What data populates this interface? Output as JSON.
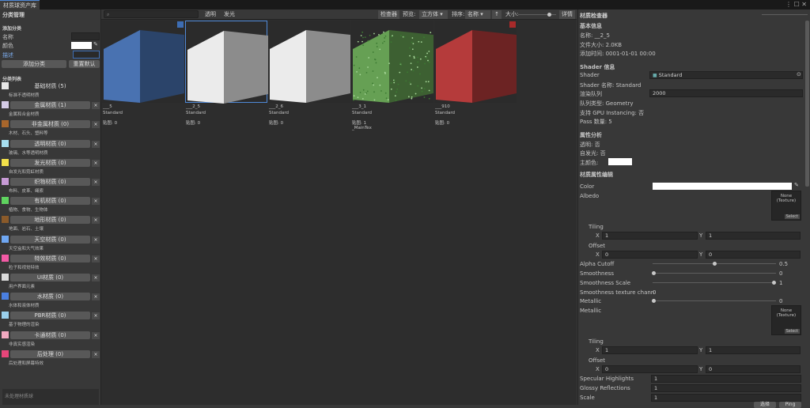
{
  "window": {
    "tab_title": "材质球资产库"
  },
  "left": {
    "section_title": "分类管理",
    "add_title": "添加分类",
    "name_label": "名称",
    "color_label": "颜色",
    "desc_label": "描述",
    "add_btn": "添加分类",
    "reset_btn": "重置默认",
    "list_title": "分类列表",
    "footer": "未处理材质球",
    "categories": [
      {
        "label": "基础材质 (5)",
        "desc": "标准不透明材质",
        "color": "#e6e6e6"
      },
      {
        "label": "金属材质 (1)",
        "desc": "金属和合金材质",
        "color": "#d4cbe6"
      },
      {
        "label": "非金属材质 (0)",
        "desc": "木材、石头、塑料等",
        "color": "#a8662c"
      },
      {
        "label": "透明材质 (0)",
        "desc": "玻璃、水等透明材质",
        "color": "#a7dff0"
      },
      {
        "label": "发光材质 (0)",
        "desc": "自发光和霓虹材质",
        "color": "#f2e04a"
      },
      {
        "label": "织物材质 (0)",
        "desc": "布料、皮革、绳索",
        "color": "#c89bd6"
      },
      {
        "label": "有机材质 (0)",
        "desc": "植物、食物、生物体",
        "color": "#5fd35f"
      },
      {
        "label": "地形材质 (0)",
        "desc": "地面、岩石、土壤",
        "color": "#8a5a2a"
      },
      {
        "label": "天空材质 (0)",
        "desc": "天空盒和大气效果",
        "color": "#6fa7f2"
      },
      {
        "label": "特效材质 (0)",
        "desc": "粒子和视觉特效",
        "color": "#f25aa5"
      },
      {
        "label": "UI材质 (0)",
        "desc": "用户界面元素",
        "color": "#d9d9d9"
      },
      {
        "label": "水材质 (0)",
        "desc": "水体和液体材质",
        "color": "#4a7fe0"
      },
      {
        "label": "PBR材质 (0)",
        "desc": "基于物理的渲染",
        "color": "#9ad0ec"
      },
      {
        "label": "卡通材质 (0)",
        "desc": "非真实感渲染",
        "color": "#f2a9c0"
      },
      {
        "label": "后处理 (0)",
        "desc": "后处理和屏幕特效",
        "color": "#e8467a"
      }
    ]
  },
  "toolbar": {
    "search_placeholder": "",
    "transparent": "透明",
    "emissive": "发光",
    "inspector": "检查器",
    "preview_label": "预览:",
    "preview_value": "立方体",
    "sort_label": "排序:",
    "sort_value": "名称",
    "sort_dir": "↑",
    "size_label": "大小:",
    "details": "详情"
  },
  "materials": [
    {
      "name": "___5",
      "shader": "Standard",
      "maps": "贴图: 0",
      "color": "#4f7cc0",
      "marker": "#3d6db3"
    },
    {
      "name": "___2_5",
      "shader": "Standard",
      "maps": "贴图: 0",
      "color": "#ffffff",
      "marker": ""
    },
    {
      "name": "___2_6",
      "shader": "Standard",
      "maps": "贴图: 0",
      "color": "#ffffff",
      "marker": ""
    },
    {
      "name": "___3_1",
      "shader": "Standard",
      "maps": "贴图: 1\n_MainTex",
      "color": "#6fae5b",
      "marker": ""
    },
    {
      "name": "___910",
      "shader": "Standard",
      "maps": "贴图: 0",
      "color": "#c54040",
      "marker": "#a82a2a"
    }
  ],
  "inspector": {
    "title": "材质检查器",
    "basic_title": "基本信息",
    "name_row": "名称: __2_5",
    "size_row": "文件大小: 2.0KB",
    "time_row": "添加时间: 0001-01-01 00:00",
    "shader_title": "Shader 信息",
    "shader_label": "Shader",
    "shader_value": "Standard",
    "shader_name": "Shader 名称: Standard",
    "queue_label": "渲染队列",
    "queue_value": "2000",
    "queue_type": "队列类型: Geometry",
    "gpu": "支持 GPU Instancing: 否",
    "pass": "Pass 数量: 5",
    "analysis_title": "属性分析",
    "transparent": "透明: 否",
    "emissive": "自发光: 否",
    "main_color": "主颜色:",
    "edit_title": "材质属性编辑",
    "color_label": "Color",
    "albedo": "Albedo",
    "tex_none": "None\n(Texture)",
    "select": "Select",
    "tiling": "Tiling",
    "offset": "Offset",
    "x": "X",
    "y": "Y",
    "tiling_x": "1",
    "tiling_y": "1",
    "offset_x": "0",
    "offset_y": "0",
    "alpha_cutoff": "Alpha Cutoff",
    "alpha_value": "0.5",
    "smoothness": "Smoothness",
    "smoothness_value": "0",
    "smoothness_scale": "Smoothness Scale",
    "smoothness_scale_value": "1",
    "smoothness_channel": "Smoothness texture chann",
    "smoothness_channel_value": "0",
    "metallic": "Metallic",
    "metallic_value": "0",
    "metallic_tex": "Metallic",
    "tiling2_x": "1",
    "tiling2_y": "1",
    "offset2_x": "0",
    "offset2_y": "0",
    "specular": "Specular Highlights",
    "specular_value": "1",
    "glossy": "Glossy Reflections",
    "glossy_value": "1",
    "scale": "Scale",
    "scale_value": "1",
    "bottom_btn1": "选择",
    "bottom_btn2": "Ping"
  }
}
